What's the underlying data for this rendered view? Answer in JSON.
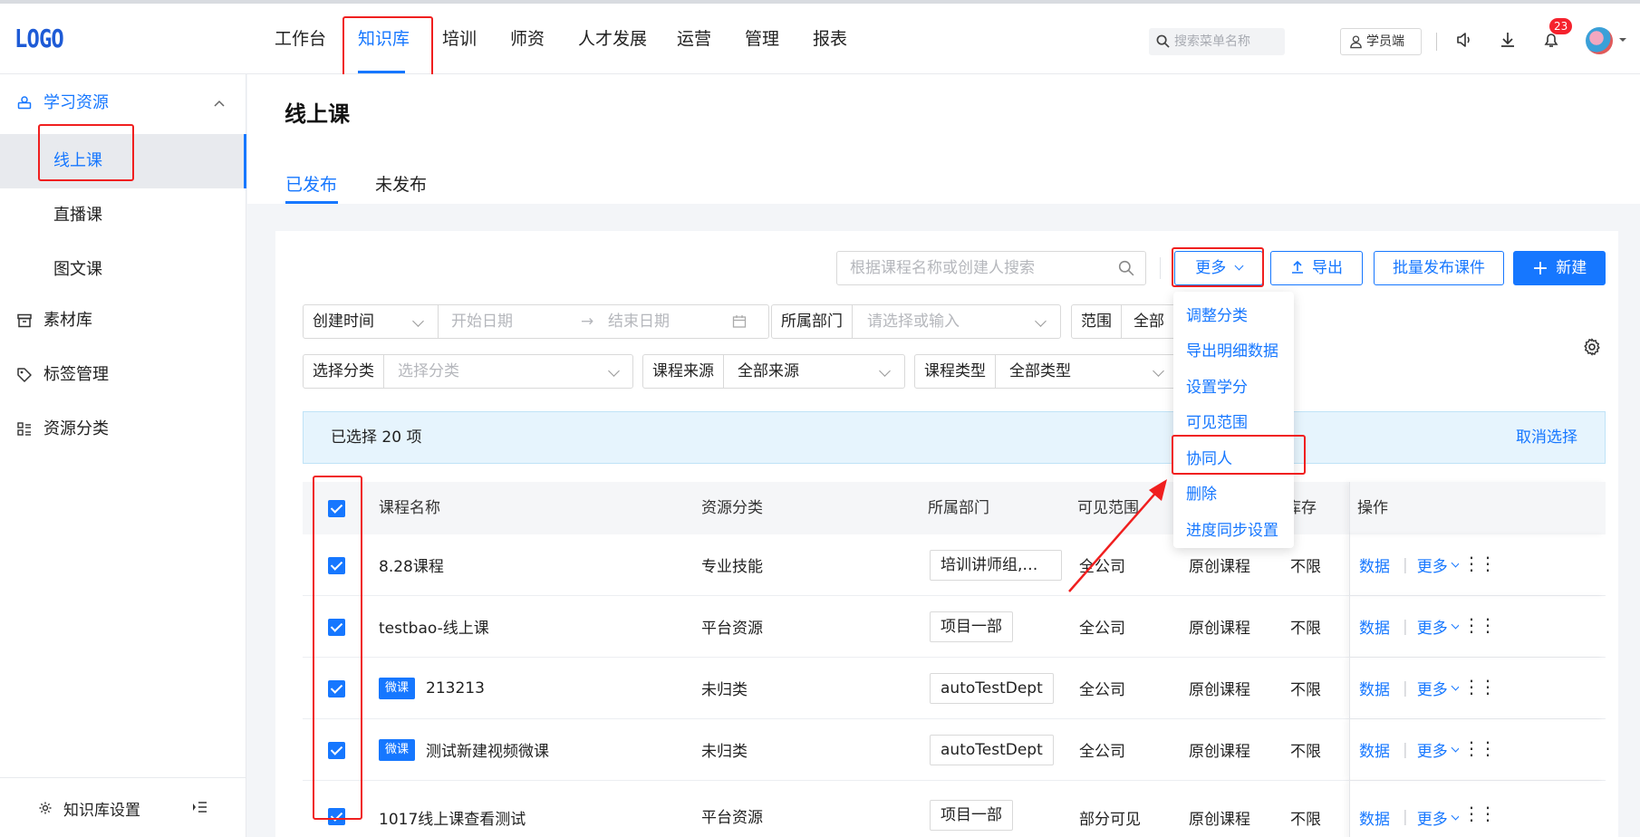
{
  "logo": "LOGO",
  "nav": [
    {
      "label": "工作台"
    },
    {
      "label": "知识库"
    },
    {
      "label": "培训"
    },
    {
      "label": "师资"
    },
    {
      "label": "人才发展"
    },
    {
      "label": "运营"
    },
    {
      "label": "管理"
    },
    {
      "label": "报表"
    }
  ],
  "header": {
    "search_placeholder": "搜索菜单名称",
    "student_label": "学员端",
    "notification_count": "23"
  },
  "sidebar": {
    "group_label": "学习资源",
    "items": [
      {
        "label": "线上课"
      },
      {
        "label": "直播课"
      },
      {
        "label": "图文课"
      }
    ],
    "others": [
      {
        "label": "素材库"
      },
      {
        "label": "标签管理"
      },
      {
        "label": "资源分类"
      }
    ],
    "footer_label": "知识库设置"
  },
  "page": {
    "title": "线上课",
    "tabs": [
      {
        "label": "已发布"
      },
      {
        "label": "未发布"
      }
    ]
  },
  "toolbar": {
    "search_placeholder": "根据课程名称或创建人搜索",
    "more_label": "更多",
    "export_label": "导出",
    "batch_publish_label": "批量发布课件",
    "create_label": "新建"
  },
  "filters": {
    "time_label": "创建时间",
    "start_placeholder": "开始日期",
    "end_placeholder": "结束日期",
    "dept_label": "所属部门",
    "dept_placeholder": "请选择或输入",
    "scope_label": "范围",
    "scope_value": "全部",
    "category_label": "选择分类",
    "category_placeholder": "选择分类",
    "source_label": "课程来源",
    "source_value": "全部来源",
    "type_label": "课程类型",
    "type_value": "全部类型"
  },
  "selection": {
    "text": "已选择  20  项",
    "cancel_label": "取消选择"
  },
  "more_menu": [
    {
      "label": "调整分类"
    },
    {
      "label": "导出明细数据"
    },
    {
      "label": "设置学分"
    },
    {
      "label": "可见范围"
    },
    {
      "label": "协同人"
    },
    {
      "label": "删除"
    },
    {
      "label": "进度同步设置"
    }
  ],
  "table": {
    "headers": {
      "name": "课程名称",
      "category": "资源分类",
      "dept": "所属部门",
      "scope": "可见范围",
      "stock": "库存",
      "ops": "操作"
    },
    "rows": [
      {
        "tag": "",
        "name": "8.28课程",
        "category": "专业技能",
        "dept": "培训讲师组,培...",
        "scope": "全公司",
        "source": "原创课程",
        "stock": "不限"
      },
      {
        "tag": "",
        "name": "testbao-线上课",
        "category": "平台资源",
        "dept": "项目一部",
        "scope": "全公司",
        "source": "原创课程",
        "stock": "不限"
      },
      {
        "tag": "微课",
        "name": "213213",
        "category": "未归类",
        "dept": "autoTestDept",
        "scope": "全公司",
        "source": "原创课程",
        "stock": "不限"
      },
      {
        "tag": "微课",
        "name": "测试新建视频微课",
        "category": "未归类",
        "dept": "autoTestDept",
        "scope": "全公司",
        "source": "原创课程",
        "stock": "不限"
      },
      {
        "tag": "",
        "name": "1017线上课查看测试",
        "category": "平台资源",
        "dept": "项目一部",
        "scope": "部分可见",
        "source": "原创课程",
        "stock": "不限"
      }
    ],
    "op_data_label": "数据",
    "op_more_label": "更多"
  },
  "colors": {
    "accent": "#1677ff",
    "highlight": "#f01f1f"
  }
}
